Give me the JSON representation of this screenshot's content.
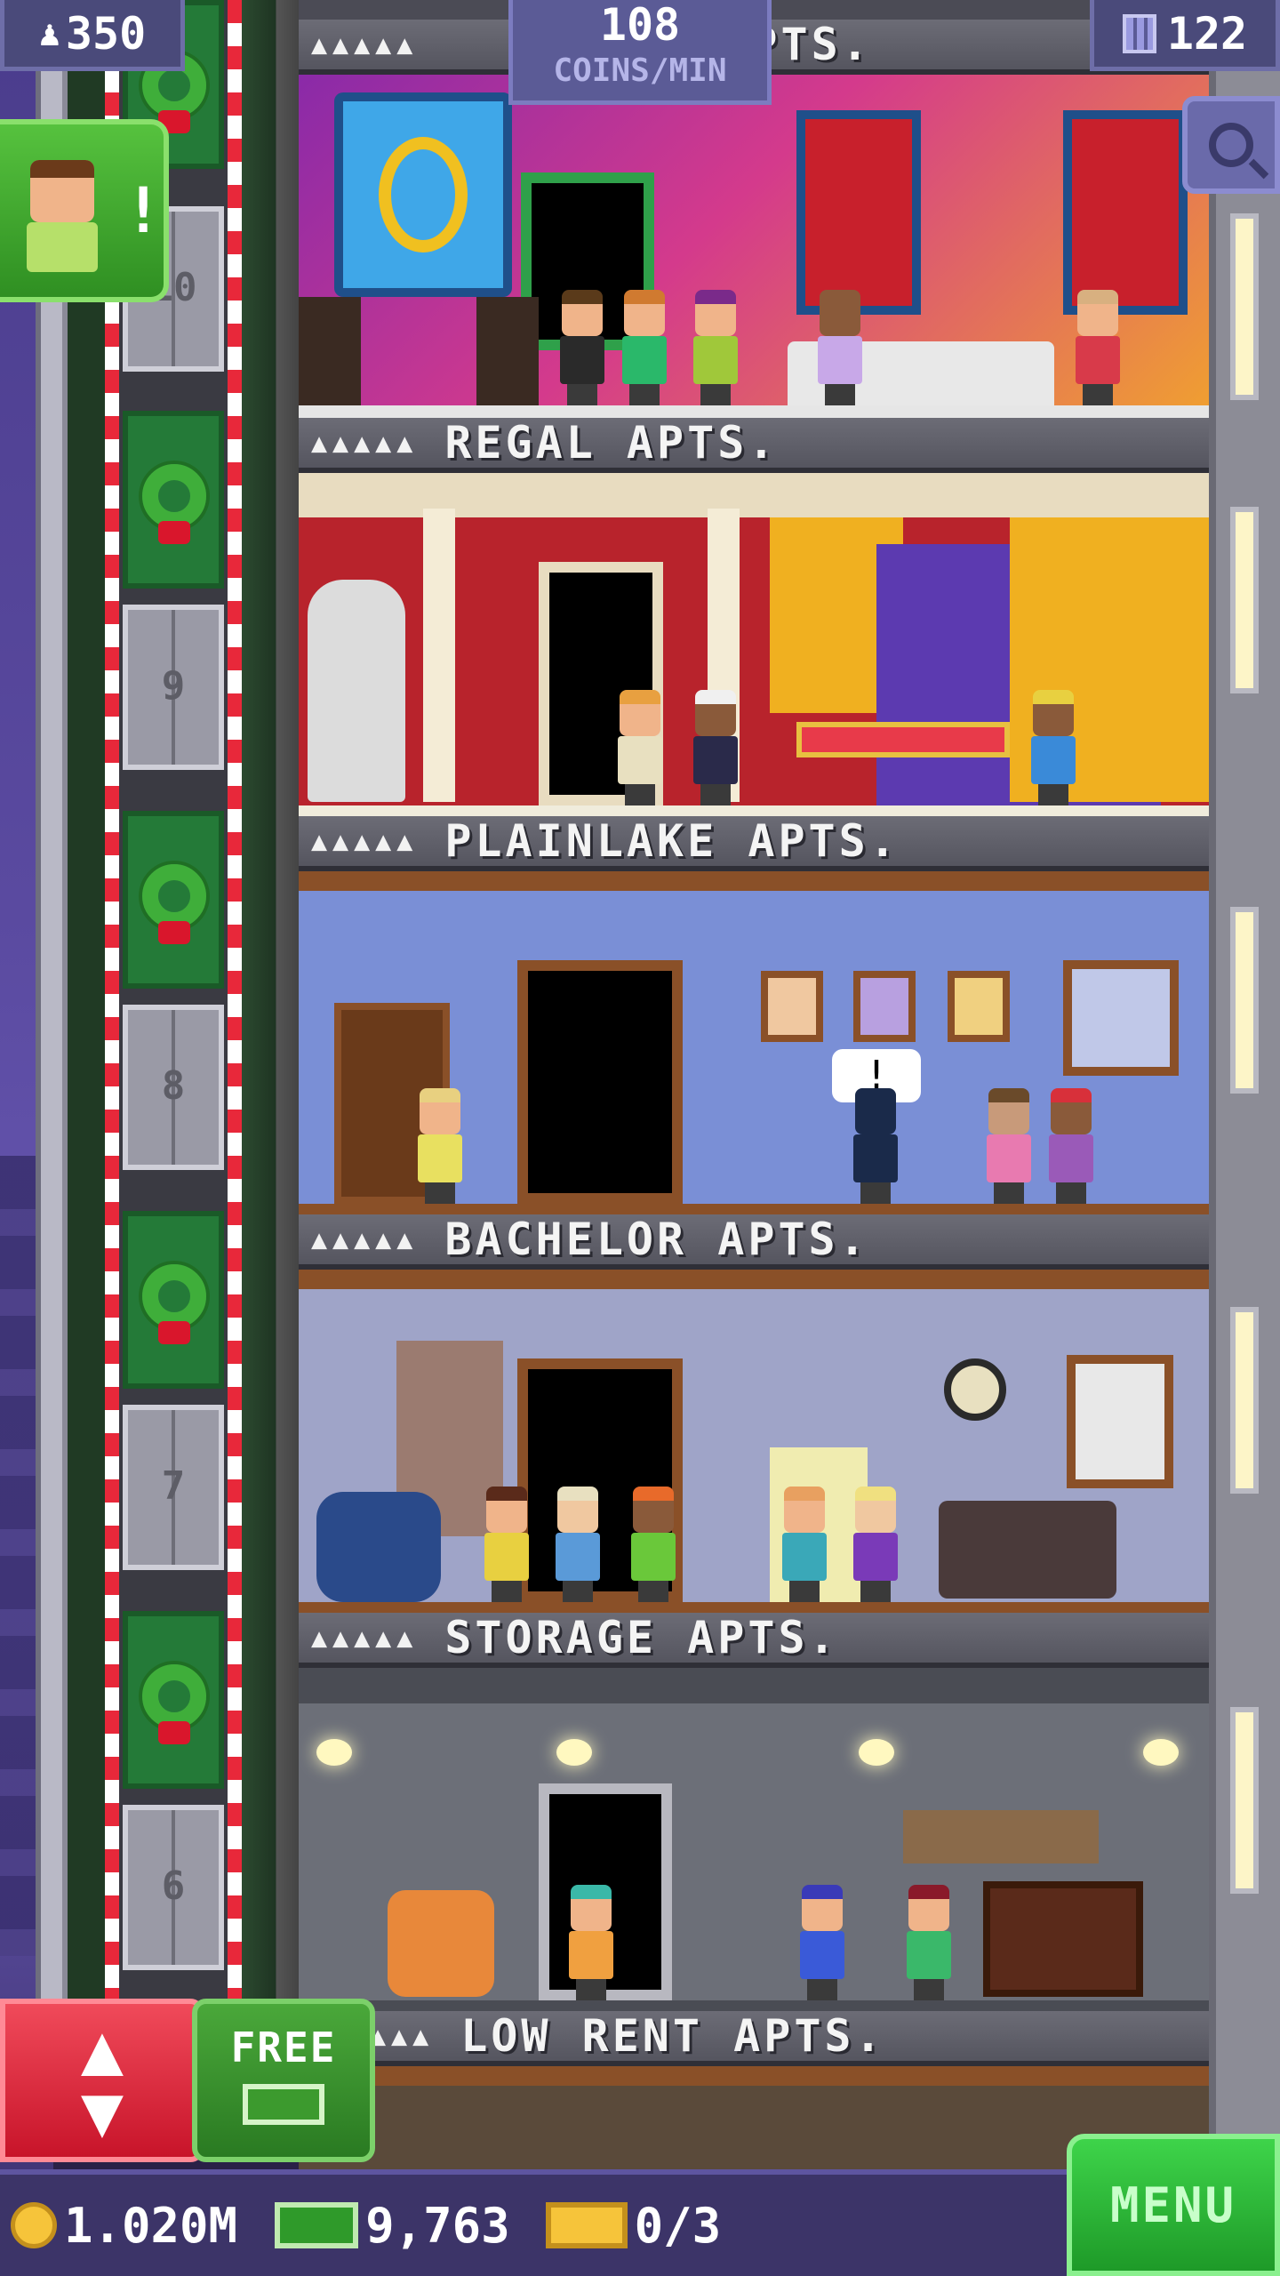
{
  "hud": {
    "population": "350",
    "coins_per_min_value": "108",
    "coins_per_min_label": "COINS/MIN",
    "floor_count": "122"
  },
  "elevator": {
    "floor_numbers": [
      "10",
      "9",
      "8",
      "7",
      "6"
    ]
  },
  "floors": [
    {
      "stars": "▲▲▲▲▲",
      "name": "APTS.",
      "room_color": "#c23a9c"
    },
    {
      "stars": "▲▲▲▲▲",
      "name": "REGAL APTS.",
      "room_color": "#b8232c"
    },
    {
      "stars": "▲▲▲▲▲",
      "name": "PLAINLAKE APTS.",
      "room_color": "#7a8fd6"
    },
    {
      "stars": "▲▲▲▲▲",
      "name": "BACHELOR APTS.",
      "room_color": "#9fa4c8"
    },
    {
      "stars": "▲▲▲▲▲",
      "name": "STORAGE APTS.",
      "room_color": "#6c6f78"
    },
    {
      "stars": "▲▲▲",
      "name": "LOW RENT APTS.",
      "room_color": "#5a4a3a"
    }
  ],
  "notification": {
    "bang": "!"
  },
  "buttons": {
    "elevator_arrows": "▲\n▼",
    "free_label": "FREE",
    "menu_label": "MENU"
  },
  "bottom": {
    "coins": "1.020M",
    "bux": "9,763",
    "tickets": "0/3"
  },
  "colors": {
    "accent_green": "#2f9a2a",
    "accent_red": "#d9162c",
    "hud_purple": "#5b5b96"
  }
}
